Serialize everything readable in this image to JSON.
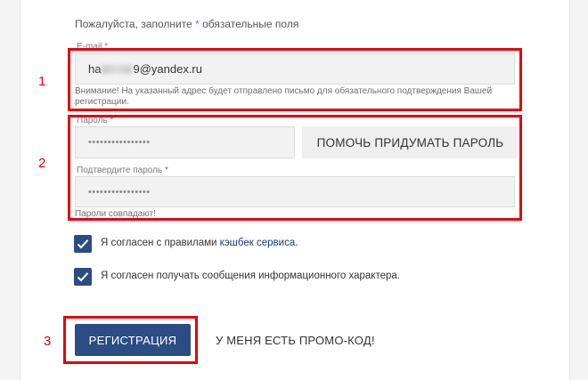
{
  "form": {
    "hint_before": "Пожалуйста, заполните ",
    "hint_star": "*",
    "hint_after": " обязательные поля",
    "email_label": "E-mail *",
    "email_prefix": "ha",
    "email_suffix": "9@yandex.ru",
    "email_note": "Внимание! На указанный адрес будет отправлено письмо для обязательного подтверждения Вашей регистрации.",
    "password_label": "Пароль *",
    "password_value": "••••••••••••••••",
    "help_button": "ПОМОЧЬ ПРИДУМАТЬ ПАРОЛЬ",
    "confirm_label": "Подтвердите пароль *",
    "confirm_value": "••••••••••••••••",
    "match_text": "Пароли совпадают!",
    "agree_rules_before": "Я согласен с правилами ",
    "agree_rules_link": "кэшбек сервиса",
    "agree_rules_after": ".",
    "agree_info": "Я согласен получать сообщения информационного характера.",
    "register_button": "РЕГИСТРАЦИЯ",
    "promo_link": "У МЕНЯ ЕСТЬ ПРОМО-КОД!"
  },
  "annotations": {
    "n1": "1",
    "n2": "2",
    "n3": "3"
  },
  "colors": {
    "accent": "#2b4c84",
    "annotation": "#e4000f"
  }
}
